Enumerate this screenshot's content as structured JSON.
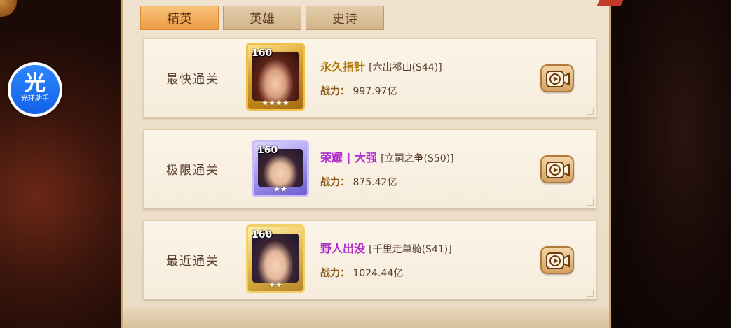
{
  "helper_app": {
    "glyph": "光",
    "label": "光环助手"
  },
  "tabs": [
    {
      "label": "精英",
      "active": true
    },
    {
      "label": "英雄",
      "active": false
    },
    {
      "label": "史诗",
      "active": false
    }
  ],
  "entries": [
    {
      "label": "最快通关",
      "level": "160",
      "player": "永久指针",
      "player_color": "#b07a10",
      "server": "[六出祁山(S44)]",
      "power_label": "战力：",
      "power": "997.97亿",
      "frame": "gold",
      "icon": "play-video-icon"
    },
    {
      "label": "极限通关",
      "level": "160",
      "player": "荣耀 | 大强",
      "player_color": "#b02ad0",
      "server": "[立嗣之争(S50)]",
      "power_label": "战力：",
      "power": "875.42亿",
      "frame": "purple",
      "icon": "play-video-icon"
    },
    {
      "label": "最近通关",
      "level": "160",
      "player": "野人出没",
      "player_color": "#b02ad0",
      "server": "[千里走单骑(S41)]",
      "power_label": "战力：",
      "power": "1024.44亿",
      "frame": "gold",
      "icon": "play-video-icon"
    }
  ]
}
